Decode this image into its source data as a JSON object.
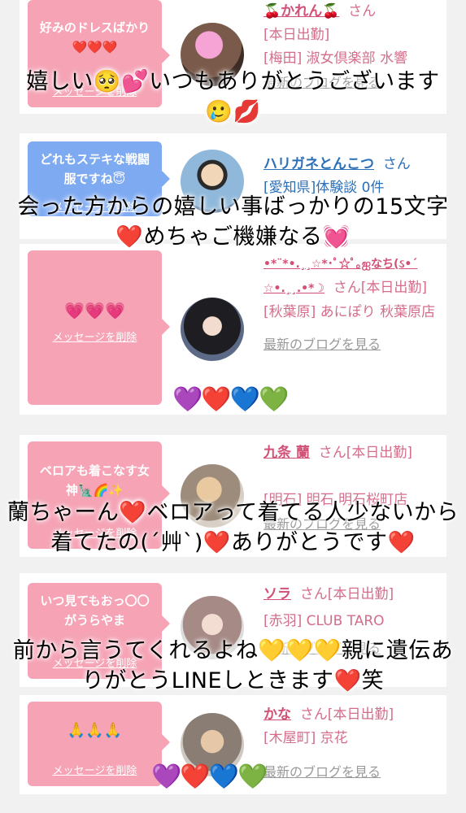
{
  "cards": [
    {
      "bubble_text": "好みのドレスばかり❤️❤️❤️",
      "delete_label": "メッセージを削除",
      "name": "🍒かれん🍒",
      "san": "さん",
      "lines": [
        "[本日出勤]",
        "[梅田] 淑女倶楽部 水響"
      ],
      "blog": "最新のブログを見る"
    },
    {
      "bubble_text": "どれもステキな戦闘服ですね😇",
      "delete_label": "メッセージを削除",
      "name": "ハリガネとんこつ",
      "san": "さん",
      "lines": [
        "[愛知県]体験談 0件"
      ],
      "blog": ""
    },
    {
      "bubble_text": "💗💗💗",
      "delete_label": "メッセージを削除",
      "name": "•*¨*•.¸¸☆*･ﾟ☆ﾟ｡ஐなち(ઽ•´",
      "name2": "☆•.¸¸.•*☽",
      "san": "さん[本日出勤]",
      "lines": [
        "[秋葉原] あにぽり 秋葉原店"
      ],
      "blog": "最新のブログを見る"
    },
    {
      "bubble_text": "ベロアも着こなす女神🗽🌈✨",
      "delete_label": "メッセージを削除",
      "name": "九条 蘭",
      "san": "さん[本日出勤]",
      "lines": [
        "[明石] 明石 明石桜町店"
      ],
      "blog": "最新のブログを見る"
    },
    {
      "bubble_text": "いつ見てもおっ〇〇がうらやま",
      "delete_label": "メッセージを削除",
      "name": "ソラ",
      "san": "さん[本日出勤]",
      "lines": [
        "[赤羽] CLUB TARO"
      ],
      "blog": "最新のブログを見る"
    },
    {
      "bubble_text": "🙏🙏🙏",
      "delete_label": "メッセージを削除",
      "name": "かな",
      "san": "さん[本日出勤]",
      "lines": [
        "[木屋町] 京花"
      ],
      "blog": "最新のブログを見る"
    }
  ],
  "overlays": [
    "嬉しい🥺💕いつもありがとうございます🥲💋",
    "会った方からの嬉しい事ばっかりの15文字❤️めちゃご機嫌なる💓",
    "蘭ちゃーん❤️ベロアって着てる人少ないから着てたの(´艸`)❤️ありがとうです❤️",
    "前から言うてくれるよね💛💛💛親に遺伝ありがとうLINEしときます❤️笑"
  ],
  "heart_rows": [
    "💜❤️💙💚",
    "💜❤️💙💚"
  ],
  "colors": {
    "pink_bubble": "#f5a3b5",
    "blue_bubble": "#7eaaf2",
    "name_pink": "#d24f75",
    "name_blue": "#2b6fb7"
  }
}
